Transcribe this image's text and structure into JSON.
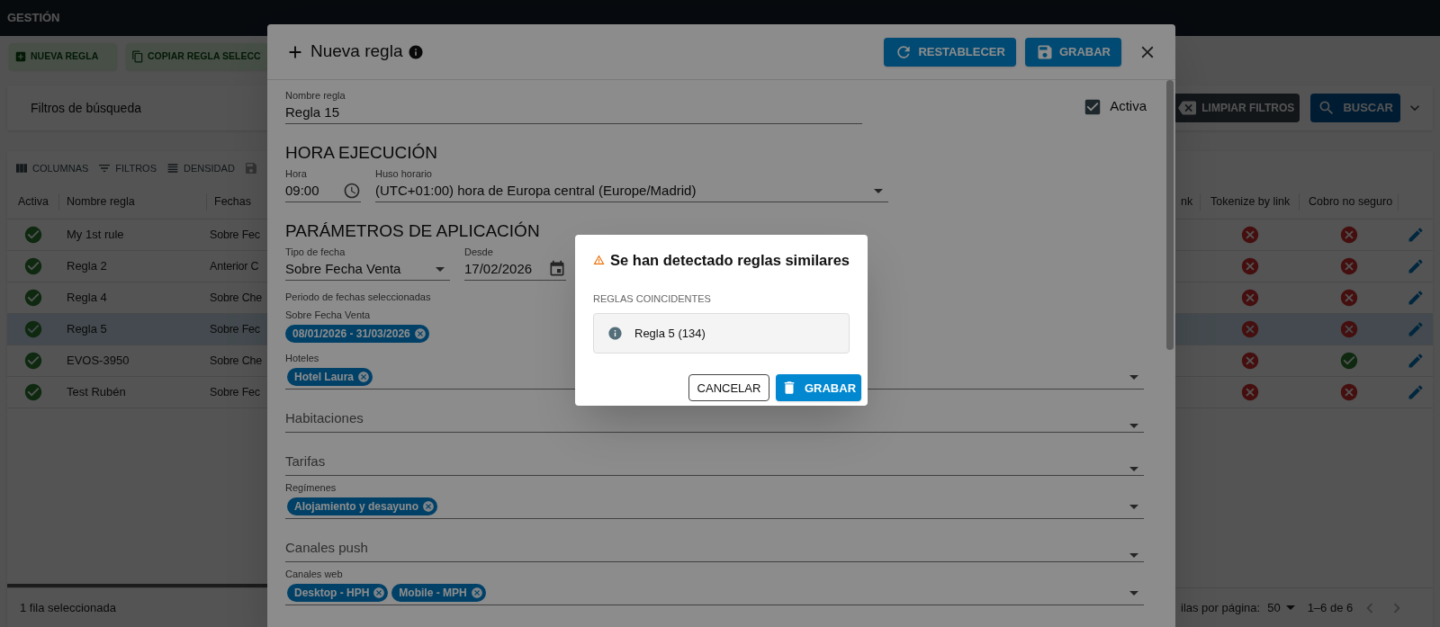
{
  "app": {
    "title": "GESTIÓN"
  },
  "toolbar": {
    "buttons": [
      "NUEVA REGLA",
      "COPIAR REGLA SELECC"
    ]
  },
  "filters": {
    "title": "Filtros de búsqueda",
    "clear_button": "LIMPIAR FILTROS",
    "search_button": "BUSCAR"
  },
  "grid_toolbar": [
    "COLUMNAS",
    "FILTROS",
    "DENSIDAD"
  ],
  "table": {
    "columns": [
      "Activa",
      "Nombre regla",
      "Fechas",
      "nk",
      "Tokenize by link",
      "Cobro no seguro"
    ],
    "rows": [
      {
        "active": true,
        "name": "My 1st rule",
        "fechas": "Sobre Fec",
        "tokenize": false,
        "cobro": false,
        "selected": false
      },
      {
        "active": true,
        "name": "Regla 2",
        "fechas": "Anterior C",
        "tokenize": false,
        "cobro": false,
        "selected": false
      },
      {
        "active": true,
        "name": "Regla 4",
        "fechas": "Sobre Che",
        "tokenize": false,
        "cobro": false,
        "selected": false
      },
      {
        "active": true,
        "name": "Regla 5",
        "fechas": "Sobre Fec",
        "tokenize": false,
        "cobro": false,
        "selected": true
      },
      {
        "active": true,
        "name": "EVOS-3950",
        "fechas": "Sobre Che",
        "tokenize": false,
        "cobro": true,
        "selected": false
      },
      {
        "active": true,
        "name": "Test Rubén",
        "fechas": "Sobre Fec",
        "tokenize": false,
        "cobro": false,
        "selected": false
      }
    ]
  },
  "footer": {
    "selection": "1 fila seleccionada",
    "rows_per_page_label": "ilas por página:",
    "rows_per_page": "50",
    "range": "1–6 de 6"
  },
  "rule_dialog": {
    "title": "Nueva regla",
    "reset_button": "RESTABLECER",
    "save_button": "GRABAR",
    "name_field": {
      "label": "Nombre regla",
      "value": "Regla 15"
    },
    "active": {
      "label": "Activa",
      "checked": true
    },
    "schedule": {
      "heading": "HORA EJECUCIÓN",
      "time": {
        "label": "Hora",
        "value": "09:00"
      },
      "timezone": {
        "label": "Huso horario",
        "value": "(UTC+01:00) hora de Europa central (Europe/Madrid)"
      }
    },
    "params": {
      "heading": "PARÁMETROS DE APLICACIÓN",
      "date_type": {
        "label": "Tipo de fecha",
        "value": "Sobre Fecha Venta"
      },
      "from": {
        "label": "Desde",
        "value": "17/02/2026"
      },
      "period_label": "Periodo de fechas seleccionadas",
      "period_group": "Sobre Fecha Venta",
      "period_chips": [
        "08/01/2026 - 31/03/2026"
      ],
      "selects": [
        {
          "label": "Hoteles",
          "chips": [
            "Hotel Laura"
          ]
        },
        {
          "placeholder": "Habitaciones"
        },
        {
          "placeholder": "Tarifas"
        },
        {
          "label": "Regímenes",
          "chips": [
            "Alojamiento y desayuno"
          ]
        },
        {
          "placeholder": "Canales push"
        },
        {
          "label": "Canales web",
          "chips": [
            "Desktop - HPH",
            "Mobile - MPH"
          ]
        }
      ]
    }
  },
  "similar_dialog": {
    "title": "Se han detectado reglas similares",
    "section": "REGLAS COINCIDENTES",
    "matches": [
      "Regla 5 (134)"
    ],
    "cancel_button": "CANCELAR",
    "save_button": "GRABAR"
  }
}
